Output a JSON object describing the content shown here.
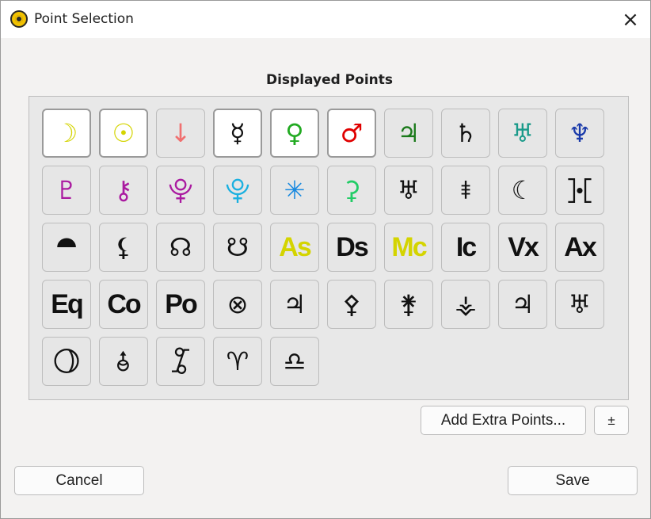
{
  "window": {
    "title": "Point Selection",
    "close_glyph": "×"
  },
  "section": {
    "title": "Displayed Points"
  },
  "points": [
    {
      "glyph": "☽",
      "color": "#d4d400",
      "selected": true,
      "icon": "moon-icon"
    },
    {
      "glyph": "☉",
      "color": "#d4d400",
      "selected": true,
      "icon": "sun-icon"
    },
    {
      "glyph": "↓",
      "color": "#f07070",
      "selected": false,
      "icon": "arrow-down-icon"
    },
    {
      "glyph": "☿",
      "color": "#111111",
      "selected": true,
      "icon": "mercury-icon"
    },
    {
      "glyph": "♀",
      "color": "#22aa22",
      "selected": true,
      "icon": "venus-icon"
    },
    {
      "glyph": "♂",
      "color": "#e00000",
      "selected": true,
      "icon": "mars-icon"
    },
    {
      "glyph": "♃",
      "color": "#1b7a1b",
      "selected": false,
      "icon": "jupiter-icon"
    },
    {
      "glyph": "♄",
      "color": "#111111",
      "selected": false,
      "icon": "saturn-icon"
    },
    {
      "glyph": "♅",
      "color": "#1a9a8a",
      "selected": false,
      "icon": "uranus-icon"
    },
    {
      "glyph": "♆",
      "color": "#1a3aaa",
      "selected": false,
      "icon": "neptune-icon"
    },
    {
      "glyph": "♇",
      "color": "#aa1aa0",
      "selected": false,
      "icon": "pluto-icon"
    },
    {
      "glyph": "⚷",
      "color": "#aa1aa0",
      "selected": false,
      "icon": "chiron-icon"
    },
    {
      "glyph": "⯓",
      "color": "#aa1aa0",
      "selected": false,
      "icon": "pluto-alt-icon"
    },
    {
      "glyph": "⯓",
      "color": "#1ab0e0",
      "selected": false,
      "icon": "eris-icon"
    },
    {
      "glyph": "✳",
      "color": "#1a8ae0",
      "selected": false,
      "icon": "asterisk-icon"
    },
    {
      "glyph": "⚳",
      "color": "#22cc66",
      "selected": false,
      "icon": "ceres-icon"
    },
    {
      "glyph": "♅",
      "color": "#111111",
      "selected": false,
      "icon": "uranus-alt-icon"
    },
    {
      "glyph": "⯒",
      "color": "#111111",
      "selected": false,
      "icon": "sedna-icon"
    },
    {
      "glyph": "☾",
      "color": "#111111",
      "selected": false,
      "icon": "lilith-icon"
    },
    {
      "glyph": "⯘",
      "color": "#111111",
      "selected": false,
      "icon": "proserpina-icon"
    },
    {
      "glyph": "⯊",
      "color": "#111111",
      "selected": false,
      "icon": "point-icon-1"
    },
    {
      "glyph": "⚸",
      "color": "#111111",
      "selected": false,
      "icon": "point-icon-2"
    },
    {
      "glyph": "☊",
      "color": "#111111",
      "selected": false,
      "icon": "north-node-icon"
    },
    {
      "glyph": "☋",
      "color": "#111111",
      "selected": false,
      "icon": "south-node-icon"
    },
    {
      "glyph": "As",
      "color": "#d4d400",
      "selected": false,
      "icon": "ascendant-icon",
      "abbr": true
    },
    {
      "glyph": "Ds",
      "color": "#111111",
      "selected": false,
      "icon": "descendant-icon",
      "abbr": true
    },
    {
      "glyph": "Mc",
      "color": "#d4d400",
      "selected": false,
      "icon": "midheaven-icon",
      "abbr": true
    },
    {
      "glyph": "Ic",
      "color": "#111111",
      "selected": false,
      "icon": "imum-coeli-icon",
      "abbr": true
    },
    {
      "glyph": "Vx",
      "color": "#111111",
      "selected": false,
      "icon": "vertex-icon",
      "abbr": true
    },
    {
      "glyph": "Ax",
      "color": "#111111",
      "selected": false,
      "icon": "antivertex-icon",
      "abbr": true
    },
    {
      "glyph": "Eq",
      "color": "#111111",
      "selected": false,
      "icon": "equatorial-ascendant-icon",
      "abbr": true
    },
    {
      "glyph": "Co",
      "color": "#111111",
      "selected": false,
      "icon": "co-ascendant-icon",
      "abbr": true
    },
    {
      "glyph": "Po",
      "color": "#111111",
      "selected": false,
      "icon": "polar-ascendant-icon",
      "abbr": true
    },
    {
      "glyph": "⊗",
      "color": "#111111",
      "selected": false,
      "icon": "part-of-fortune-icon"
    },
    {
      "glyph": "♃",
      "color": "#111111",
      "selected": false,
      "icon": "point-icon-3"
    },
    {
      "glyph": "⚴",
      "color": "#111111",
      "selected": false,
      "icon": "pallas-icon"
    },
    {
      "glyph": "⚵",
      "color": "#111111",
      "selected": false,
      "icon": "juno-icon"
    },
    {
      "glyph": "⚶",
      "color": "#111111",
      "selected": false,
      "icon": "vesta-icon"
    },
    {
      "glyph": "♃",
      "color": "#111111",
      "selected": false,
      "icon": "point-icon-4"
    },
    {
      "glyph": "♅",
      "color": "#111111",
      "selected": false,
      "icon": "point-icon-5"
    },
    {
      "glyph": "⯖",
      "color": "#111111",
      "selected": false,
      "icon": "point-icon-6"
    },
    {
      "glyph": "⯗",
      "color": "#111111",
      "selected": false,
      "icon": "point-icon-7"
    },
    {
      "glyph": "⯙",
      "color": "#111111",
      "selected": false,
      "icon": "point-icon-8"
    },
    {
      "glyph": "♈",
      "color": "#111111",
      "selected": false,
      "icon": "aries-icon"
    },
    {
      "glyph": "♎",
      "color": "#111111",
      "selected": false,
      "icon": "libra-icon"
    }
  ],
  "buttons": {
    "add_extra": "Add Extra Points...",
    "plus_minus": "±",
    "cancel": "Cancel",
    "save": "Save"
  }
}
